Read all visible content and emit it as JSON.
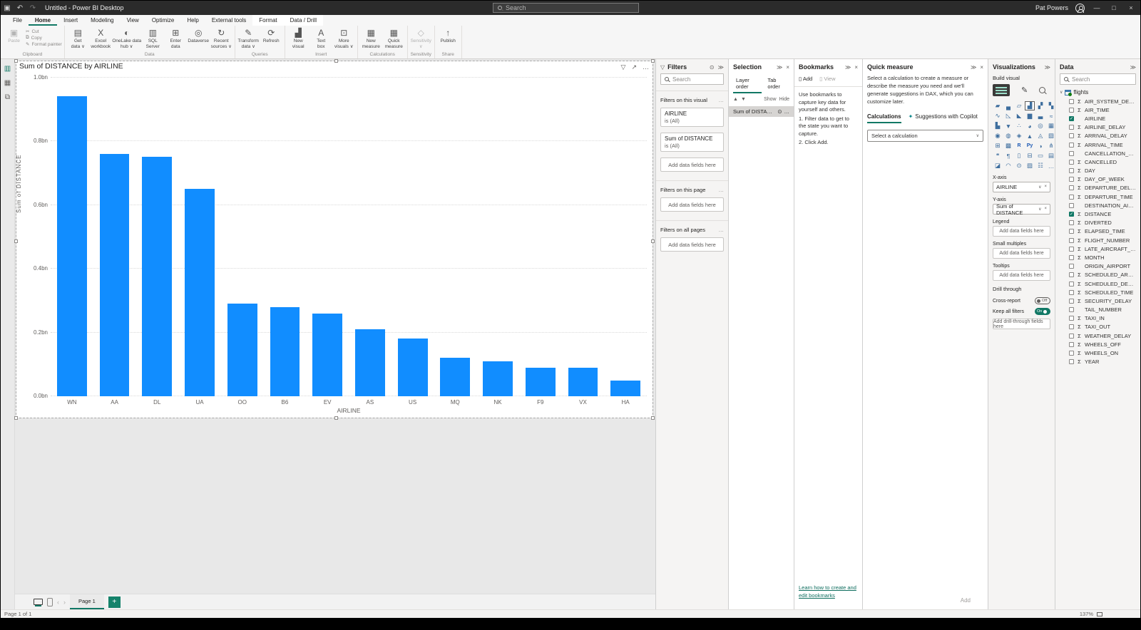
{
  "colors": {
    "accent": "#117865",
    "bar_blue": "#118DFF",
    "titlebar": "#2b2b2b",
    "canvas": "#e8e8e8"
  },
  "titlebar": {
    "title": "Untitled - Power BI Desktop",
    "search_placeholder": "Search",
    "user": "Pat Powers",
    "minimize": "—",
    "maximize": "□",
    "close": "×",
    "save": "▣",
    "undo": "↶",
    "redo": "↷"
  },
  "menu": {
    "items": [
      {
        "label": "File"
      },
      {
        "label": "Home",
        "cls": "active"
      },
      {
        "label": "Insert"
      },
      {
        "label": "Modeling"
      },
      {
        "label": "View"
      },
      {
        "label": "Optimize"
      },
      {
        "label": "Help"
      },
      {
        "label": "External tools"
      },
      {
        "label": "Format",
        "cls": "contextual"
      },
      {
        "label": "Data / Drill",
        "cls": "contextual"
      }
    ]
  },
  "ribbon": {
    "clipboard": {
      "label": "Clipboard",
      "paste": "Paste",
      "cut": "Cut",
      "copy": "Copy",
      "format_painter": "Format painter"
    },
    "data": {
      "label": "Data",
      "buttons": [
        {
          "l1": "Get",
          "l2": "data ∨",
          "glyph": "▤"
        },
        {
          "l1": "Excel",
          "l2": "workbook",
          "glyph": "X",
          "cls": "excel-btn"
        },
        {
          "l1": "OneLake data",
          "l2": "hub ∨",
          "glyph": "◐",
          "cls": "wide"
        },
        {
          "l1": "SQL",
          "l2": "Server",
          "glyph": "▥"
        },
        {
          "l1": "Enter",
          "l2": "data",
          "glyph": "⊞"
        },
        {
          "l1": "Dataverse",
          "l2": "",
          "glyph": "◎"
        },
        {
          "l1": "Recent",
          "l2": "sources ∨",
          "glyph": "↻"
        }
      ]
    },
    "queries": {
      "label": "Queries",
      "buttons": [
        {
          "l1": "Transform",
          "l2": "data ∨",
          "glyph": "✎",
          "cls": "teal-btn"
        },
        {
          "l1": "Refresh",
          "l2": "",
          "glyph": "⟳",
          "cls": "green-btn"
        }
      ]
    },
    "insert": {
      "label": "Insert",
      "buttons": [
        {
          "l1": "New",
          "l2": "visual",
          "glyph": "▟",
          "cls": "blue-btn"
        },
        {
          "l1": "Text",
          "l2": "box",
          "glyph": "A"
        },
        {
          "l1": "More",
          "l2": "visuals ∨",
          "glyph": "⊡"
        }
      ]
    },
    "calculations": {
      "label": "Calculations",
      "buttons": [
        {
          "l1": "New",
          "l2": "measure",
          "glyph": "▦"
        },
        {
          "l1": "Quick",
          "l2": "measure",
          "glyph": "▦"
        }
      ]
    },
    "sensitivity": {
      "label": "Sensitivity",
      "buttons": [
        {
          "l1": "Sensitivity",
          "l2": "∨",
          "glyph": "◇",
          "cls": "disabled"
        }
      ]
    },
    "share": {
      "label": "Share",
      "buttons": [
        {
          "l1": "Publish",
          "l2": "",
          "glyph": "↑"
        }
      ]
    }
  },
  "chart_data": {
    "type": "bar",
    "title": "Sum of DISTANCE by AIRLINE",
    "xlabel": "AIRLINE",
    "ylabel": "Sum of DISTANCE",
    "categories": [
      "WN",
      "AA",
      "DL",
      "UA",
      "OO",
      "B6",
      "EV",
      "AS",
      "US",
      "MQ",
      "NK",
      "F9",
      "VX",
      "HA"
    ],
    "values": [
      0.94,
      0.76,
      0.75,
      0.65,
      0.29,
      0.28,
      0.26,
      0.21,
      0.18,
      0.12,
      0.11,
      0.09,
      0.09,
      0.05
    ],
    "value_unit": "bn",
    "yticks": [
      "1.0bn",
      "0.8bn",
      "0.6bn",
      "0.4bn",
      "0.2bn",
      "0.0bn"
    ],
    "ylim": [
      0,
      1.0
    ],
    "grid": true,
    "legend": "none",
    "bar_color": "#118DFF"
  },
  "visual_header": {
    "filter_icon": "▽",
    "focus_icon": "↗",
    "more_icon": "…"
  },
  "filters_pane": {
    "title": "Filters",
    "collapse": "≫",
    "eye": "⊙",
    "search_placeholder": "Search",
    "section_visual": "Filters on this visual",
    "section_page": "Filters on this page",
    "section_all": "Filters on all pages",
    "more": "…",
    "cards": [
      {
        "field": "AIRLINE",
        "condition": "is (All)"
      },
      {
        "field": "Sum of DISTANCE",
        "condition": "is (All)"
      }
    ],
    "add_placeholder": "Add data fields here"
  },
  "selection_pane": {
    "title": "Selection",
    "collapse": "≫",
    "close": "×",
    "tab_layer": "Layer order",
    "tab_tab": "Tab order",
    "up": "▲",
    "down": "▼",
    "show": "Show",
    "hide": "Hide",
    "item": "Sum of DISTANCE by …",
    "item_eye": "⊙",
    "item_more": "…"
  },
  "bookmarks_pane": {
    "title": "Bookmarks",
    "collapse": "≫",
    "close": "×",
    "add": "Add",
    "view": "View",
    "body": "Use bookmarks to capture key data for yourself and others.",
    "step1": "1. Filter data to get to the state you want to capture.",
    "step2": "2. Click Add.",
    "link": "Learn how to create and edit bookmarks"
  },
  "quick_measure_pane": {
    "title": "Quick measure",
    "collapse": "≫",
    "close": "×",
    "description": "Select a calculation to create a measure or describe the measure you need and we'll generate suggestions in DAX, which you can customize later.",
    "tab_calculations": "Calculations",
    "tab_copilot": "Suggestions with Copilot",
    "copilot_spark": "✦",
    "select_placeholder": "Select a calculation",
    "add": "Add"
  },
  "visualizations_pane": {
    "title": "Visualizations",
    "collapse": "≫",
    "build_label": "Build visual",
    "icons": [
      {
        "glyph": "▰",
        "name": "stacked-bar-chart"
      },
      {
        "glyph": "▄",
        "name": "stacked-column-chart"
      },
      {
        "glyph": "▱",
        "name": "clustered-bar-chart"
      },
      {
        "glyph": "▟",
        "name": "clustered-column-chart",
        "cls": "selected"
      },
      {
        "glyph": "▞",
        "name": "100-stacked-bar-chart"
      },
      {
        "glyph": "▚",
        "name": "100-stacked-column-chart"
      },
      {
        "glyph": "∿",
        "name": "line-chart"
      },
      {
        "glyph": "◺",
        "name": "area-chart"
      },
      {
        "glyph": "◣",
        "name": "stacked-area-chart"
      },
      {
        "glyph": "▆",
        "name": "line-and-stacked-column-chart"
      },
      {
        "glyph": "▃",
        "name": "line-and-clustered-column-chart"
      },
      {
        "glyph": "≈",
        "name": "ribbon-chart"
      },
      {
        "glyph": "▙",
        "name": "waterfall-chart"
      },
      {
        "glyph": "▼",
        "name": "funnel-chart"
      },
      {
        "glyph": "∴",
        "name": "scatter-chart"
      },
      {
        "glyph": "◕",
        "name": "pie-chart"
      },
      {
        "glyph": "◎",
        "name": "donut-chart"
      },
      {
        "glyph": "▦",
        "name": "treemap"
      },
      {
        "glyph": "◉",
        "name": "map"
      },
      {
        "glyph": "◍",
        "name": "filled-map"
      },
      {
        "glyph": "◈",
        "name": "shape-map"
      },
      {
        "glyph": "▲",
        "name": "azure-map"
      },
      {
        "glyph": "◬",
        "name": "arcgis-map"
      },
      {
        "glyph": "▧",
        "name": "slicer"
      },
      {
        "glyph": "⊞",
        "name": "table"
      },
      {
        "glyph": "▩",
        "name": "matrix"
      },
      {
        "glyph": "R",
        "name": "r-script-visual",
        "cls": "txt"
      },
      {
        "glyph": "Py",
        "name": "python-visual",
        "cls": "txt"
      },
      {
        "glyph": "◑",
        "name": "key-influencers"
      },
      {
        "glyph": "⋔",
        "name": "decomposition-tree"
      },
      {
        "glyph": "❝",
        "name": "qa-visual"
      },
      {
        "glyph": "¶",
        "name": "smart-narrative"
      },
      {
        "glyph": "▯",
        "name": "paginated-report"
      },
      {
        "glyph": "⊟",
        "name": "power-apps-visual"
      },
      {
        "glyph": "▭",
        "name": "card"
      },
      {
        "glyph": "▤",
        "name": "multi-row-card"
      },
      {
        "glyph": "◪",
        "name": "kpi"
      },
      {
        "glyph": "◠",
        "name": "gauge"
      },
      {
        "glyph": "⊙",
        "name": "metrics"
      },
      {
        "glyph": "▨",
        "name": "scorecard"
      },
      {
        "glyph": "☷",
        "name": "paginated-table"
      },
      {
        "glyph": "…",
        "name": "get-more-visuals"
      }
    ],
    "wells": {
      "x_axis_label": "X-axis",
      "x_axis_value": "AIRLINE",
      "y_axis_label": "Y-axis",
      "y_axis_value": "Sum of DISTANCE",
      "legend_label": "Legend",
      "small_multiples_label": "Small multiples",
      "tooltips_label": "Tooltips",
      "empty_placeholder": "Add data fields here",
      "drill_label": "Drill through",
      "cross_report_label": "Cross-report",
      "cross_report_state": "Off",
      "keep_filters_label": "Keep all filters",
      "keep_filters_state": "On",
      "drill_placeholder": "Add drill-through fields here",
      "caret": "∨",
      "remove": "×"
    }
  },
  "data_pane": {
    "title": "Data",
    "collapse": "≫",
    "search_placeholder": "Search",
    "table_chevron": "∨",
    "table": "flights",
    "fields": [
      {
        "name": "AIR_SYSTEM_DE…"
      },
      {
        "name": "AIR_TIME"
      },
      {
        "name": "AIRLINE",
        "cls": "checked nosigma"
      },
      {
        "name": "AIRLINE_DELAY"
      },
      {
        "name": "ARRIVAL_DELAY"
      },
      {
        "name": "ARRIVAL_TIME"
      },
      {
        "name": "CANCELLATION_…",
        "cls": "nosigma"
      },
      {
        "name": "CANCELLED"
      },
      {
        "name": "DAY"
      },
      {
        "name": "DAY_OF_WEEK"
      },
      {
        "name": "DEPARTURE_DEL…"
      },
      {
        "name": "DEPARTURE_TIME"
      },
      {
        "name": "DESTINATION_AI…",
        "cls": "nosigma"
      },
      {
        "name": "DISTANCE",
        "cls": "checked"
      },
      {
        "name": "DIVERTED"
      },
      {
        "name": "ELAPSED_TIME"
      },
      {
        "name": "FLIGHT_NUMBER"
      },
      {
        "name": "LATE_AIRCRAFT_…"
      },
      {
        "name": "MONTH"
      },
      {
        "name": "ORIGIN_AIRPORT",
        "cls": "nosigma"
      },
      {
        "name": "SCHEDULED_AR…"
      },
      {
        "name": "SCHEDULED_DE…"
      },
      {
        "name": "SCHEDULED_TIME"
      },
      {
        "name": "SECURITY_DELAY"
      },
      {
        "name": "TAIL_NUMBER",
        "cls": "nosigma"
      },
      {
        "name": "TAXI_IN"
      },
      {
        "name": "TAXI_OUT"
      },
      {
        "name": "WEATHER_DELAY"
      },
      {
        "name": "WHEELS_OFF"
      },
      {
        "name": "WHEELS_ON"
      },
      {
        "name": "YEAR"
      }
    ]
  },
  "pages_bar": {
    "back": "‹",
    "forward": "›",
    "page_tab": "Page 1",
    "add": "+"
  },
  "status_bar": {
    "page_info": "Page 1 of 1",
    "zoom": "137%"
  }
}
